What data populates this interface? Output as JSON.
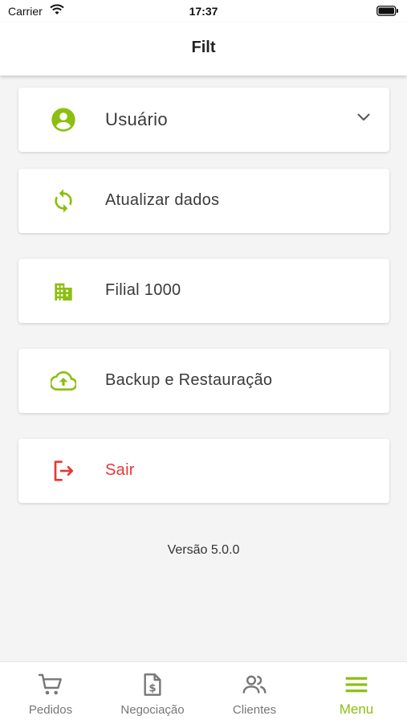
{
  "status": {
    "carrier": "Carrier",
    "time": "17:37"
  },
  "header": {
    "title": "Filt"
  },
  "menu": {
    "user": "Usuário",
    "refresh": "Atualizar dados",
    "branch": "Filial 1000",
    "backup": "Backup e Restauração",
    "logout": "Sair"
  },
  "version": "Versão 5.0.0",
  "tabs": [
    {
      "label": "Pedidos",
      "icon": "cart-icon"
    },
    {
      "label": "Negociação",
      "icon": "invoice-dollar-icon"
    },
    {
      "label": "Clientes",
      "icon": "users-icon"
    },
    {
      "label": "Menu",
      "icon": "hamburger-menu-icon",
      "active": true
    }
  ],
  "colors": {
    "accent": "#8cbf0f",
    "danger": "#e53935",
    "background": "#f4f4f4"
  }
}
